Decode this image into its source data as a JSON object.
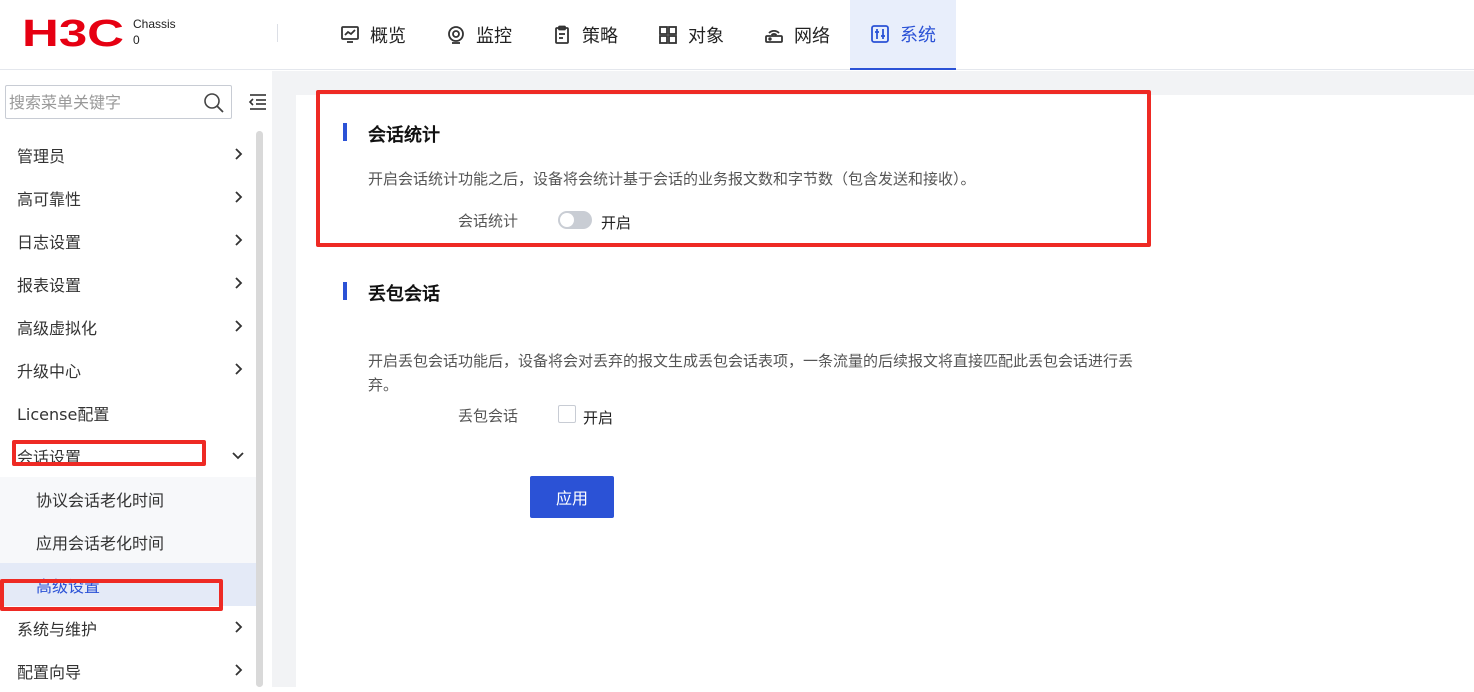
{
  "header": {
    "logo_text": "H3C",
    "device_name": "Chassis",
    "device_slot": "0",
    "nav": [
      {
        "label": "概览",
        "icon": "monitor-chart-icon"
      },
      {
        "label": "监控",
        "icon": "location-pin-icon"
      },
      {
        "label": "策略",
        "icon": "clipboard-icon"
      },
      {
        "label": "对象",
        "icon": "grid-icon"
      },
      {
        "label": "网络",
        "icon": "router-icon"
      },
      {
        "label": "系统",
        "icon": "system-settings-icon",
        "active": true
      }
    ]
  },
  "sidebar": {
    "search_placeholder": "搜索菜单关键字",
    "items": [
      {
        "label": "管理员"
      },
      {
        "label": "高可靠性"
      },
      {
        "label": "日志设置"
      },
      {
        "label": "报表设置"
      },
      {
        "label": "高级虚拟化"
      },
      {
        "label": "升级中心"
      },
      {
        "label": "License配置"
      },
      {
        "label": "会话设置",
        "expanded": true
      }
    ],
    "sub_items": [
      {
        "label": "协议会话老化时间"
      },
      {
        "label": "应用会话老化时间"
      },
      {
        "label": "高级设置",
        "active": true
      }
    ],
    "items_after": [
      {
        "label": "系统与维护"
      },
      {
        "label": "配置向导"
      }
    ]
  },
  "main": {
    "session_stats": {
      "title": "会话统计",
      "description": "开启会话统计功能之后，设备将会统计基于会话的业务报文数和字节数（包含发送和接收）。",
      "field_label": "会话统计",
      "option_label": "开启",
      "enabled": false
    },
    "drop_session": {
      "title": "丢包会话",
      "description": "开启丢包会话功能后，设备将会对丢弃的报文生成丢包会话表项，一条流量的后续报文将直接匹配此丢包会话进行丢弃。",
      "field_label": "丢包会话",
      "option_label": "开启",
      "checked": false
    },
    "apply_label": "应用"
  },
  "colors": {
    "accent": "#2b52d6",
    "highlight_red": "#ee2a24",
    "logo_red": "#e60012"
  }
}
